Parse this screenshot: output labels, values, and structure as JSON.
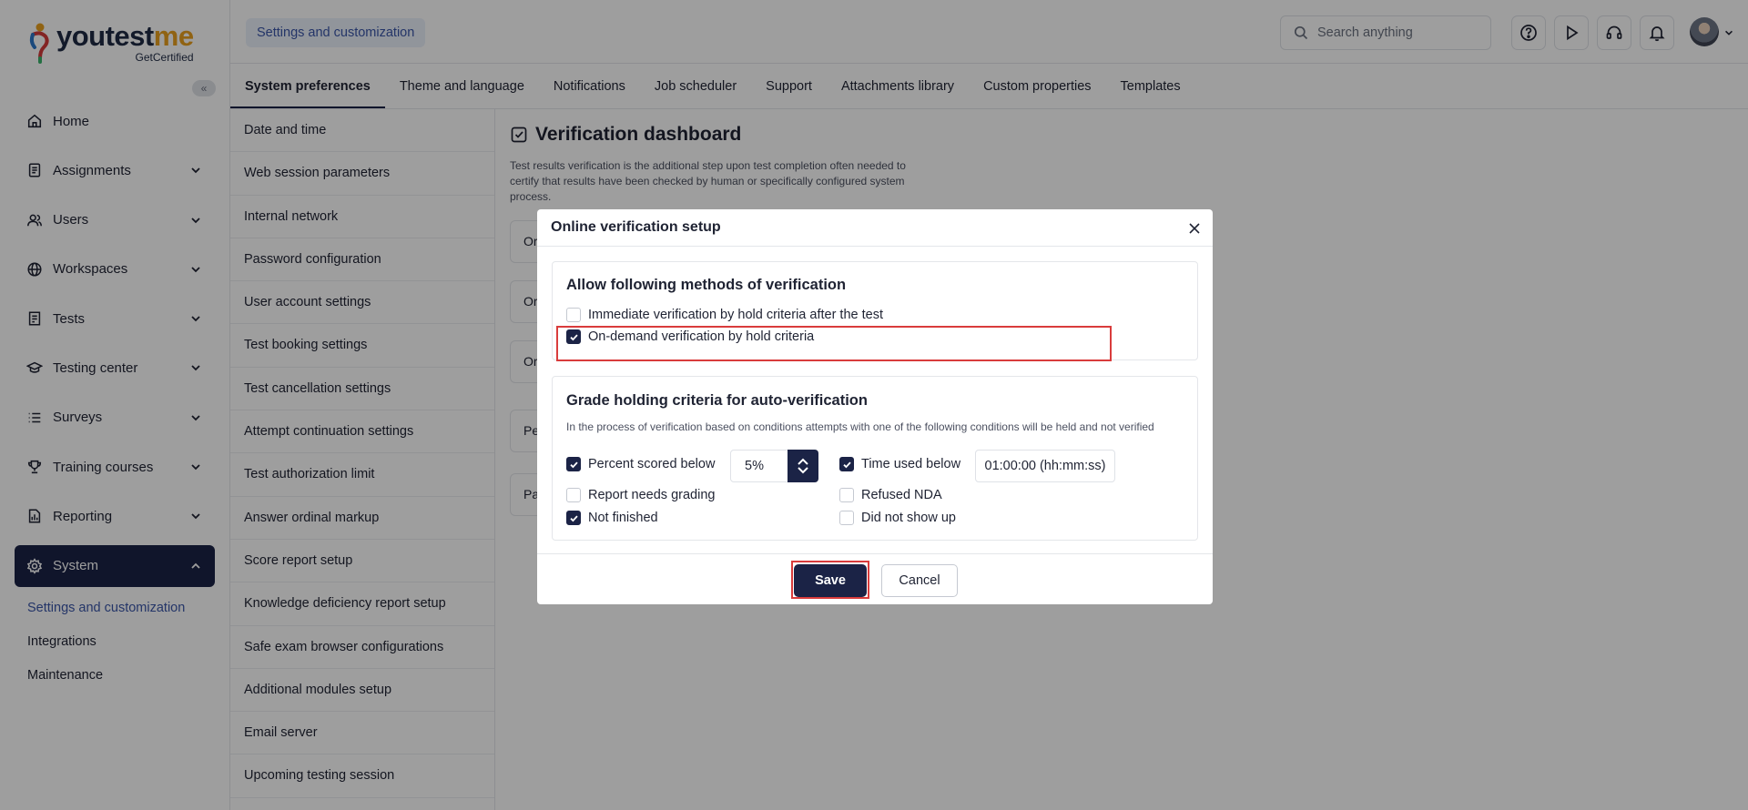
{
  "logo": {
    "word_a": "youtest",
    "word_b": "me",
    "sub": "GetCertified"
  },
  "sidebar": {
    "collapse_label": "«",
    "items": [
      {
        "label": "Home",
        "icon": "home-icon",
        "expandable": false
      },
      {
        "label": "Assignments",
        "icon": "document-icon",
        "expandable": true
      },
      {
        "label": "Users",
        "icon": "users-icon",
        "expandable": true
      },
      {
        "label": "Workspaces",
        "icon": "globe-icon",
        "expandable": true
      },
      {
        "label": "Tests",
        "icon": "test-icon",
        "expandable": true
      },
      {
        "label": "Testing center",
        "icon": "graduation-cap-icon",
        "expandable": true
      },
      {
        "label": "Surveys",
        "icon": "list-icon",
        "expandable": true
      },
      {
        "label": "Training courses",
        "icon": "trophy-icon",
        "expandable": true
      },
      {
        "label": "Reporting",
        "icon": "report-icon",
        "expandable": true
      },
      {
        "label": "System",
        "icon": "gear-icon",
        "expandable": true,
        "active": true
      }
    ],
    "sub_items": [
      "Settings and customization",
      "Integrations",
      "Maintenance"
    ]
  },
  "header": {
    "breadcrumb": "Settings and customization",
    "search_placeholder": "Search anything"
  },
  "tabs": [
    "System preferences",
    "Theme and language",
    "Notifications",
    "Job scheduler",
    "Support",
    "Attachments library",
    "Custom properties",
    "Templates"
  ],
  "settings_list": [
    "Date and time",
    "Web session parameters",
    "Internal network",
    "Password configuration",
    "User account settings",
    "Test booking settings",
    "Test cancellation settings",
    "Attempt continuation settings",
    "Test authorization limit",
    "Answer ordinal markup",
    "Score report setup",
    "Knowledge deficiency report setup",
    "Safe exam browser configurations",
    "Additional modules setup",
    "Email server",
    "Upcoming testing session"
  ],
  "dashboard": {
    "title": "Verification dashboard",
    "description": "Test results verification is the additional step upon test completion often needed to certify that results have been checked by human or specifically configured system process.",
    "cards": [
      "Or",
      "Or",
      "Or",
      "Pe",
      "Pa"
    ]
  },
  "modal": {
    "title": "Online verification setup",
    "methods": {
      "title": "Allow following methods of verification",
      "options": [
        {
          "label": "Immediate verification by hold criteria after the test",
          "checked": false
        },
        {
          "label": "On-demand verification by hold criteria",
          "checked": true
        }
      ]
    },
    "criteria": {
      "title": "Grade holding criteria for auto-verification",
      "description": "In the process of verification based on conditions attempts with one of the following conditions will be held and not verified",
      "percent_label": "Percent scored below",
      "percent_checked": true,
      "percent_value": "5%",
      "time_label": "Time used below",
      "time_checked": true,
      "time_value": "01:00:00 (hh:mm:ss)",
      "report_grading": {
        "label": "Report needs grading",
        "checked": false
      },
      "refused_nda": {
        "label": "Refused NDA",
        "checked": false
      },
      "not_finished": {
        "label": "Not finished",
        "checked": true
      },
      "did_not_show": {
        "label": "Did not show up",
        "checked": false
      }
    },
    "save_label": "Save",
    "cancel_label": "Cancel"
  },
  "colors": {
    "primary": "#1b2346",
    "accent": "#3a56a8",
    "highlight": "#d93c3c"
  }
}
